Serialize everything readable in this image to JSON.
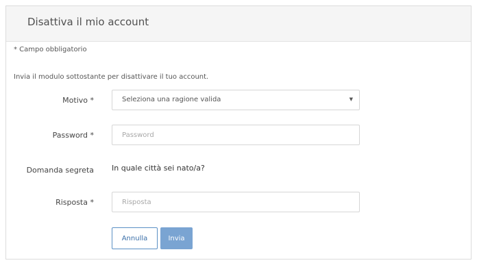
{
  "panel": {
    "title": "Disattiva il mio account"
  },
  "form": {
    "required_note": "* Campo obbligatorio",
    "intro": "Invia il modulo sottostante per disattivare il tuo account.",
    "reason": {
      "label": "Motivo *",
      "selected": "Seleziona una ragione valida"
    },
    "password": {
      "label": "Password *",
      "placeholder": "Password",
      "value": ""
    },
    "secret_question": {
      "label": "Domanda segreta",
      "question": "In quale città sei nato/a?"
    },
    "answer": {
      "label": "Risposta *",
      "placeholder": "Risposta",
      "value": ""
    },
    "buttons": {
      "cancel": "Annulla",
      "submit": "Invia"
    }
  },
  "colors": {
    "accent": "#5a8fc4",
    "submit_bg": "#7aa4d2"
  },
  "icons": {
    "select_caret": "caret-down-icon"
  }
}
